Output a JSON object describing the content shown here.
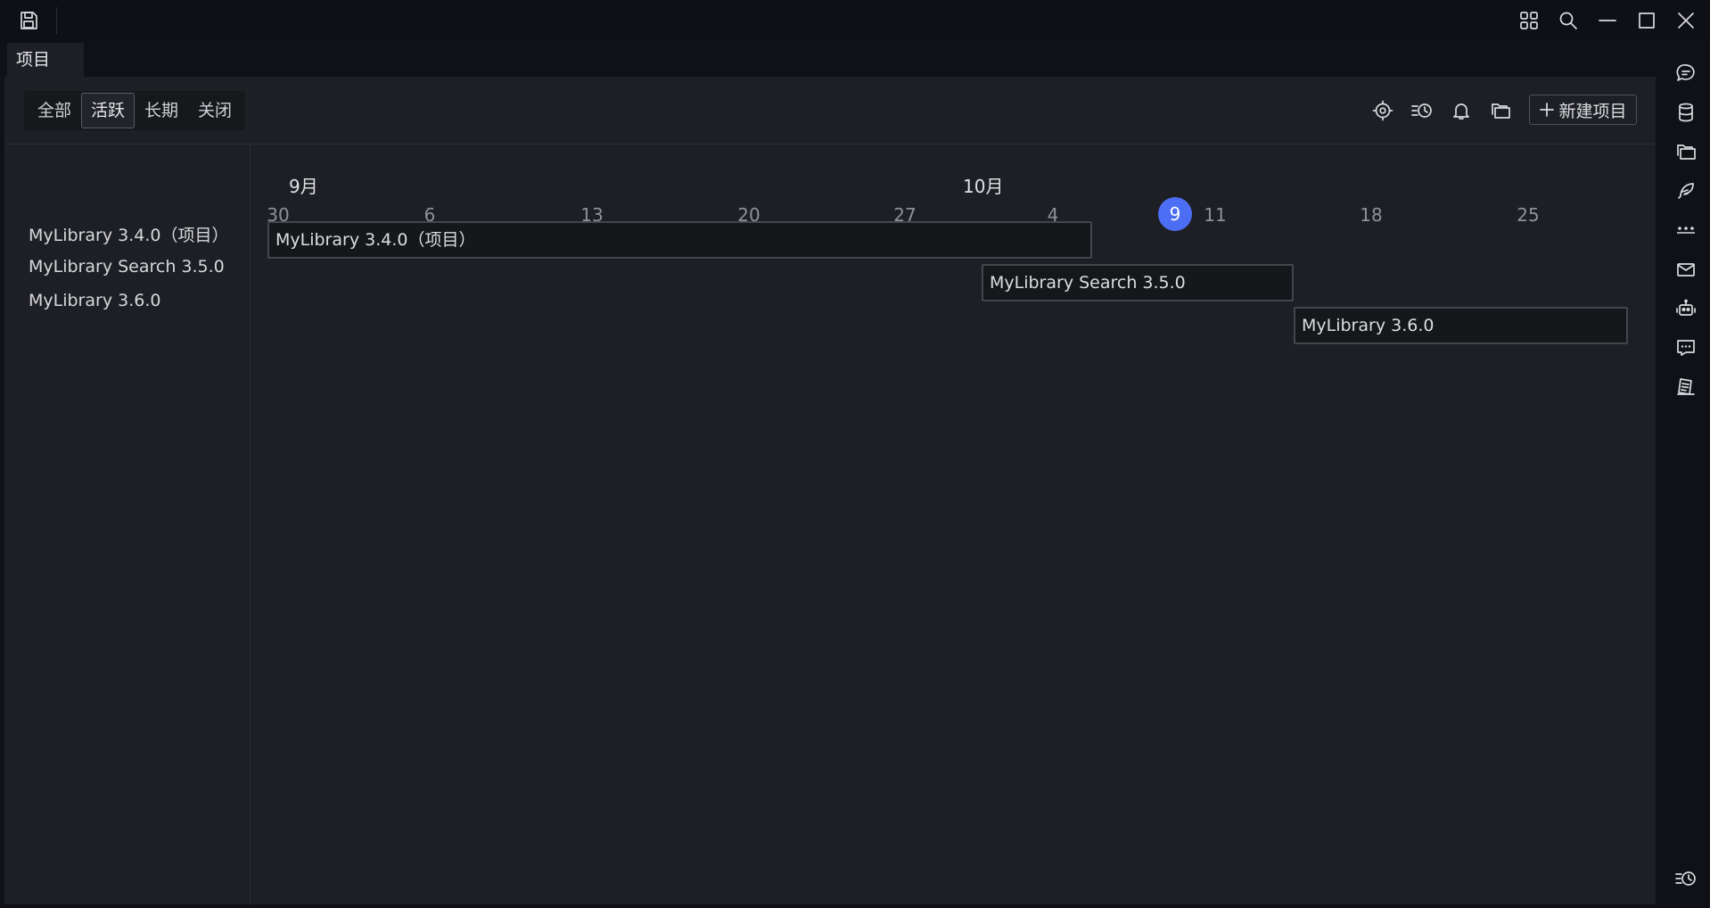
{
  "tab": {
    "label": "项目"
  },
  "filters": [
    {
      "label": "全部",
      "active": false
    },
    {
      "label": "活跃",
      "active": true
    },
    {
      "label": "长期",
      "active": false
    },
    {
      "label": "关闭",
      "active": false
    }
  ],
  "toolbar": {
    "new_label": "新建项目",
    "icons": [
      "locate-icon",
      "history-icon",
      "bell-icon",
      "folders-icon"
    ]
  },
  "projects": [
    {
      "name": "MyLibrary 3.4.0（项目）"
    },
    {
      "name": "MyLibrary Search 3.5.0"
    },
    {
      "name": "MyLibrary 3.6.0"
    }
  ],
  "timeline": {
    "months": [
      "9月",
      "10月"
    ],
    "days": [
      "30",
      "6",
      "13",
      "20",
      "27",
      "4",
      "11",
      "18",
      "25"
    ],
    "today": "9",
    "bars": [
      {
        "label": "MyLibrary 3.4.0（项目）"
      },
      {
        "label": "MyLibrary Search 3.5.0"
      },
      {
        "label": "MyLibrary 3.6.0"
      }
    ]
  },
  "colors": {
    "accent": "#4c6ef5",
    "background": "#1e1f24",
    "chrome": "#0f1015"
  },
  "right_rail_icons": [
    "chat-icon",
    "database-icon",
    "folders-icon",
    "feather-icon",
    "more-icon",
    "mail-icon",
    "robot-icon",
    "comment-icon",
    "notes-icon",
    "history-icon"
  ]
}
